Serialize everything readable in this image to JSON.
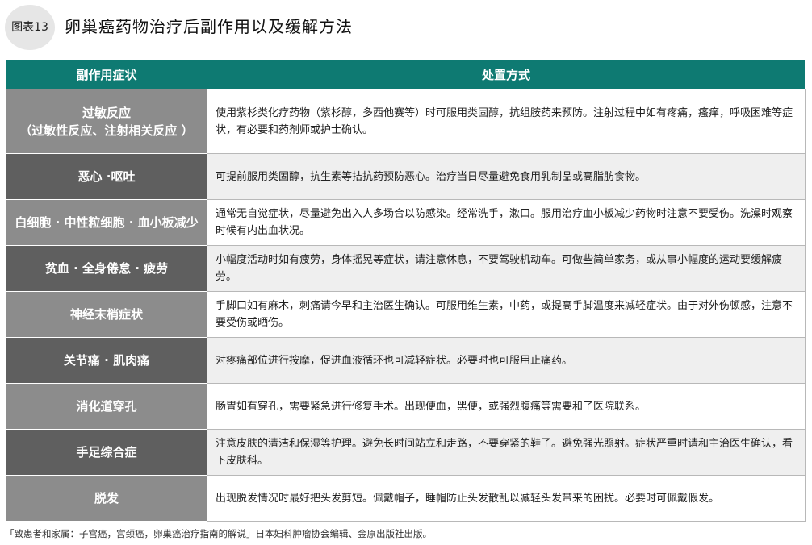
{
  "figure_label": "图表13",
  "title": "卵巢癌药物治疗后副作用以及缓解方法",
  "columns": [
    "副作用症状",
    "处置方式"
  ],
  "rows": [
    {
      "symptom": "过敏反应",
      "symptom_sub": "（过敏性反应、注射相关反应 ）",
      "treatment": "使用紫杉类化疗药物（紫杉醇，多西他赛等）时可服用类固醇，抗组胺药来预防。注射过程中如有疼痛，瘙痒，呼吸困难等症状，有必要和药剂师或护士确认。"
    },
    {
      "symptom": "恶心 ·呕吐",
      "symptom_sub": "",
      "treatment": "可提前服用类固醇，抗生素等拮抗药预防恶心。治疗当日尽量避免食用乳制品或高脂肪食物。"
    },
    {
      "symptom": "白细胞 · 中性粒细胞 · 血小板减少",
      "symptom_sub": "",
      "treatment": "通常无自觉症状，尽量避免出入人多场合以防感染。经常洗手，漱口。服用治疗血小板减少药物时注意不要受伤。洗澡时观察时候有内出血状况。"
    },
    {
      "symptom": "贫血 · 全身倦怠 · 疲劳",
      "symptom_sub": "",
      "treatment": "小幅度活动时如有疲劳，身体摇晃等症状，请注意休息，不要驾驶机动车。可做些简单家务，或从事小幅度的运动要缓解疲劳。"
    },
    {
      "symptom": "神经末梢症状",
      "symptom_sub": "",
      "treatment": "手脚口如有麻木，刺痛请今早和主治医生确认。可服用维生素，中药，或提高手脚温度来减轻症状。由于对外伤顿感，注意不要受伤或晒伤。"
    },
    {
      "symptom": "关节痛 · 肌肉痛",
      "symptom_sub": "",
      "treatment": "对疼痛部位进行按摩，促进血液循环也可减轻症状。必要时也可服用止痛药。"
    },
    {
      "symptom": "消化道穿孔",
      "symptom_sub": "",
      "treatment": "肠胃如有穿孔，需要紧急进行修复手术。出现便血，黑便，或强烈腹痛等需要和了医院联系。"
    },
    {
      "symptom": "手足综合症",
      "symptom_sub": "",
      "treatment": "注意皮肤的清洁和保湿等护理。避免长时间站立和走路，不要穿紧的鞋子。避免强光照射。症状严重时请和主治医生确认，看下皮肤科。"
    },
    {
      "symptom": "脱发",
      "symptom_sub": "",
      "treatment": "出现脱发情况时最好把头发剪短。佩戴帽子，睡帽防止头发散乱以减轻头发带来的困扰。必要时可佩戴假发。"
    }
  ],
  "source": "「致患者和家属：子宫癌，宫颈癌，卵巢癌治疗指南的解说」日本妇科肿瘤协会编辑、金原出版社出版。"
}
